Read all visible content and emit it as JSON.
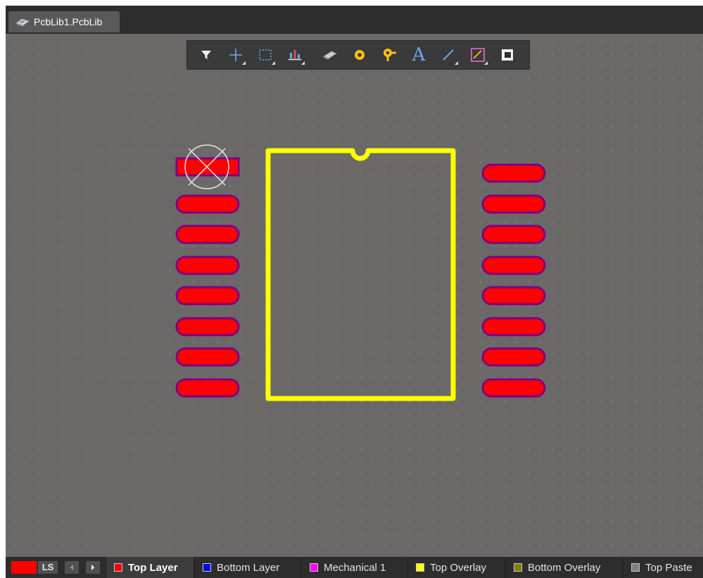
{
  "document_tab": {
    "label": "PcbLib1.PcbLib"
  },
  "toolbar": {
    "tools": [
      {
        "icon": "filter-icon"
      },
      {
        "icon": "crosshair-icon"
      },
      {
        "icon": "select-rect-icon"
      },
      {
        "icon": "align-icon"
      },
      {
        "icon": "component-icon"
      },
      {
        "icon": "pad-icon"
      },
      {
        "icon": "via-icon"
      },
      {
        "icon": "string-icon",
        "glyph": "A"
      },
      {
        "icon": "line-icon"
      },
      {
        "icon": "dimension-icon"
      },
      {
        "icon": "region-icon"
      }
    ]
  },
  "footprint": {
    "pads_per_side": 8,
    "pad_color": "#ff0000",
    "pad_outline_color": "#800080",
    "overlay_color": "#ffff00",
    "pin1_marker": "x-circle"
  },
  "status_bar": {
    "current_layer_color": "#ff0000",
    "ls_label": "LS",
    "layers": [
      {
        "label": "Top Layer",
        "color": "#ff0000",
        "active": true
      },
      {
        "label": "Bottom Layer",
        "color": "#0000ff",
        "active": false
      },
      {
        "label": "Mechanical 1",
        "color": "#ff00ff",
        "active": false
      },
      {
        "label": "Top Overlay",
        "color": "#ffff00",
        "active": false
      },
      {
        "label": "Bottom Overlay",
        "color": "#808000",
        "active": false
      },
      {
        "label": "Top Paste",
        "color": "#808080",
        "active": false
      }
    ]
  }
}
